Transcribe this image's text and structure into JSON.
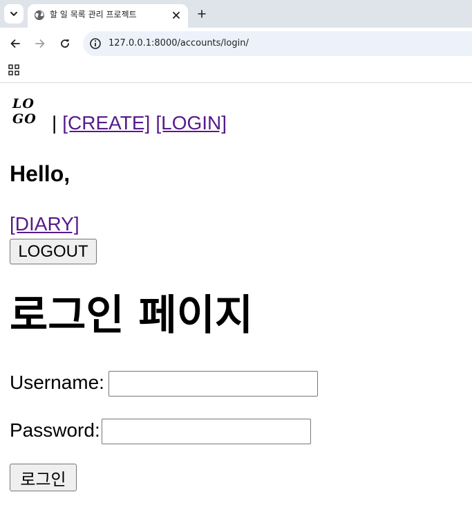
{
  "browser": {
    "tab": {
      "title": "할 일 목록 관리 프로젝트",
      "favicon": "globe-icon"
    },
    "url": "127.0.0.1:8000/accounts/login/",
    "icons": {
      "tab_menu": "chevron-down-icon",
      "tab_close": "close-icon",
      "new_tab": "plus-icon",
      "back": "back-arrow-icon",
      "forward": "forward-arrow-icon",
      "reload": "reload-icon",
      "site_info": "info-icon",
      "apps": "apps-grid-icon"
    }
  },
  "header": {
    "logo_line1": "LO",
    "logo_line2": "GO",
    "separator": "|",
    "links": {
      "create": "[CREATE]",
      "login": "[LOGIN]"
    }
  },
  "main": {
    "greeting": "Hello,",
    "diary_link": "[DIARY]",
    "logout_label": "LOGOUT",
    "title": "로그인 페이지",
    "form": {
      "username_label": "Username:",
      "username_value": "",
      "password_label": "Password:",
      "password_value": "",
      "submit_label": "로그인"
    }
  },
  "colors": {
    "visited_link": "#551a8b",
    "tabstrip_bg": "#dfe3ea",
    "omnibox_bg": "#edf2fa",
    "button_bg": "#efefef"
  }
}
